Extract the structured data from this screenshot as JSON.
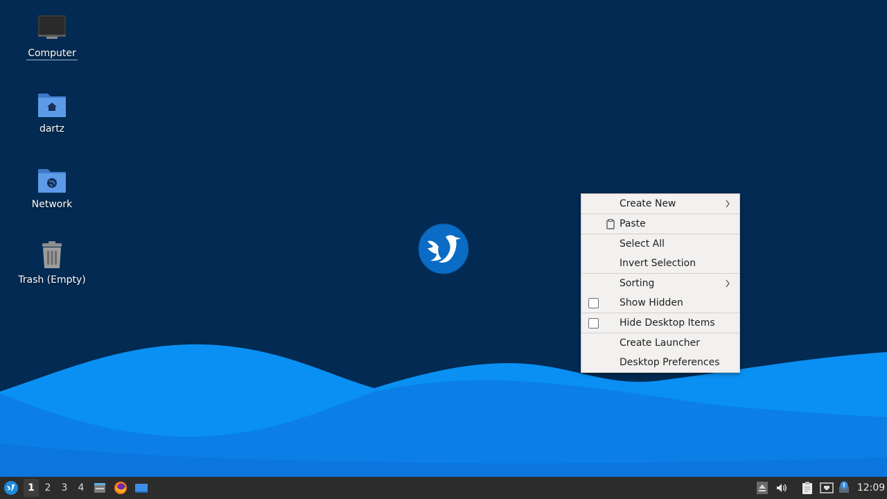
{
  "desktop": {
    "icons": [
      {
        "label": "Computer",
        "icon": "monitor-icon"
      },
      {
        "label": "dartz",
        "icon": "home-folder-icon"
      },
      {
        "label": "Network",
        "icon": "network-folder-icon"
      },
      {
        "label": "Trash (Empty)",
        "icon": "trash-icon"
      }
    ],
    "colors": {
      "background": "#022a52",
      "wave_light": "#0a8ef0",
      "wave_mid": "#0b7ce0",
      "wave_dark": "#0a5fc9"
    }
  },
  "context_menu": {
    "create_new": "Create New",
    "paste": "Paste",
    "select_all": "Select All",
    "invert_selection": "Invert Selection",
    "sorting": "Sorting",
    "show_hidden": "Show Hidden",
    "hide_desktop_items": "Hide Desktop Items",
    "create_launcher": "Create Launcher",
    "desktop_preferences": "Desktop Preferences",
    "show_hidden_checked": false,
    "hide_desktop_items_checked": false
  },
  "taskbar": {
    "workspaces": [
      "1",
      "2",
      "3",
      "4"
    ],
    "active_workspace": "1",
    "launchers": [
      "file-manager-icon",
      "firefox-icon",
      "show-desktop-icon"
    ],
    "tray": [
      "eject-icon",
      "volume-icon",
      "clipboard-icon",
      "network-wired-icon",
      "update-notifier-icon"
    ],
    "clock": "12:09"
  }
}
